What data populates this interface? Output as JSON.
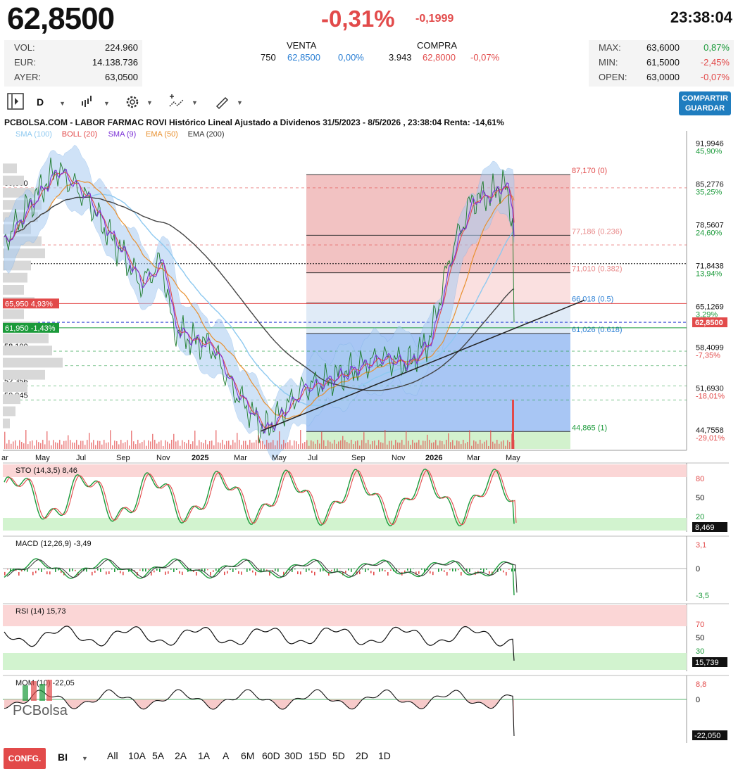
{
  "header": {
    "price": "62,8500",
    "change_pct": "-0,31%",
    "change_abs": "-0,1999",
    "time": "23:38:04"
  },
  "stats_left": [
    {
      "label": "VOL:",
      "value": "224.960"
    },
    {
      "label": "EUR:",
      "value": "14.138.736"
    },
    {
      "label": "AYER:",
      "value": "63,0500"
    }
  ],
  "book": {
    "sell_label": "VENTA",
    "buy_label": "COMPRA",
    "sell_qty": "750",
    "sell_price": "62,8500",
    "sell_pct": "0,00%",
    "buy_qty": "3.943",
    "buy_price": "62,8000",
    "buy_pct": "-0,07%"
  },
  "stats_right": [
    {
      "label": "MAX:",
      "value": "63,6000",
      "pct": "0,87%"
    },
    {
      "label": "MIN:",
      "value": "61,5000",
      "pct": "-2,45%"
    },
    {
      "label": "OPEN:",
      "value": "63,0000",
      "pct": "-0,07%"
    }
  ],
  "toolbar": {
    "period": "D",
    "share_line1": "COMPARTIR",
    "share_line2": "GUARDAR"
  },
  "chart_title": "PCBOLSA.COM - LABOR FARMAC ROVI Histórico Lineal Ajustado a Dividenos 31/5/2023 - 8/5/2026 , 23:38:04 Renta: -14,61%",
  "legend": [
    {
      "name": "SMA (100)",
      "color": "#8ec9f0"
    },
    {
      "name": "BOLL (20)",
      "color": "#e24a4a"
    },
    {
      "name": "SMA (9)",
      "color": "#7a2fd6"
    },
    {
      "name": "EMA (50)",
      "color": "#e8902f"
    },
    {
      "name": "EMA (200)",
      "color": "#333333"
    }
  ],
  "left_price_labels": [
    "85,000",
    "75,600",
    "58,100",
    "55,700",
    "52,356",
    "50,045"
  ],
  "tag_red": "65,950  4,93%",
  "tag_green": "61,950  -1,43%",
  "right_axis": [
    {
      "price": "91,9946",
      "pct": "45,90%"
    },
    {
      "price": "85,2776",
      "pct": "35,25%"
    },
    {
      "price": "78,5607",
      "pct": "24,60%"
    },
    {
      "price": "71,8438",
      "pct": "13,94%"
    },
    {
      "price": "65,1269",
      "pct": "3,29%"
    },
    {
      "price": "58,4099",
      "pct": "-7,35%"
    },
    {
      "price": "51,6930",
      "pct": "-18,01%"
    },
    {
      "price": "44,7558",
      "pct": "-29,01%"
    }
  ],
  "current_tag": "62,8500",
  "fib_levels": [
    {
      "label": "87,170 (0)"
    },
    {
      "label": "77,186 (0.236)"
    },
    {
      "label": "71,010 (0.382)"
    },
    {
      "label": "66,018 (0.5)"
    },
    {
      "label": "61,026 (0.618)"
    },
    {
      "label": "44,865 (1)"
    }
  ],
  "x_axis": [
    "ar",
    "May",
    "Jul",
    "Sep",
    "Nov",
    "2025",
    "Mar",
    "May",
    "Jul",
    "Sep",
    "Nov",
    "2026",
    "Mar",
    "May"
  ],
  "indicators": {
    "sto": {
      "label": "STO (14,3,5)",
      "value": "8,46",
      "levels": [
        "80",
        "50",
        "20"
      ],
      "tag": "8,469"
    },
    "macd": {
      "label": "MACD (12,26,9)",
      "value": "-3,49",
      "top": "3,1",
      "zero": "0",
      "bottom": "-3,5"
    },
    "rsi": {
      "label": "RSI (14)",
      "value": "15,73",
      "levels": [
        "70",
        "50",
        "30"
      ],
      "tag": "15,739"
    },
    "mom": {
      "label": "MOM (10)",
      "value": "-22,05",
      "top": "8,8",
      "zero": "0",
      "tag": "-22,050"
    }
  },
  "logo_text": "PCBolsa",
  "bottom": {
    "config": "CONFG.",
    "style": "BI",
    "ranges": [
      "All",
      "10A",
      "5A",
      "2A",
      "1A",
      "A",
      "6M",
      "60D",
      "30D",
      "15D",
      "5D",
      "2D",
      "1D"
    ]
  },
  "chart_data": {
    "type": "line",
    "title": "PCBOLSA.COM - LABOR FARMAC ROVI Histórico Lineal Ajustado a Dividenos 31/5/2023 - 8/5/2026 , 23:38:04 Renta: -14,61%",
    "ylim": [
      42,
      96
    ],
    "x": [
      "May",
      "Jul",
      "Sep",
      "Nov",
      "2025",
      "Mar",
      "May",
      "Jul",
      "Sep",
      "Nov",
      "2026",
      "Mar",
      "May"
    ],
    "series": [
      {
        "name": "",
        "values": [
          85,
          80,
          73,
          73,
          62,
          57,
          47,
          55,
          57,
          60,
          62,
          84,
          62.85
        ]
      }
    ],
    "fib_levels": [
      87.17,
      77.186,
      71.01,
      66.018,
      61.026,
      44.865
    ]
  }
}
